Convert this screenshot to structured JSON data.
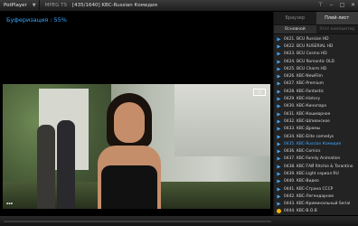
{
  "titlebar": {
    "app_name": "PotPlayer",
    "codec": "MPEG TS",
    "file_title": "[435/1640] KBC-Russian Комедия"
  },
  "video": {
    "buffering_text": "Буферизация : 55%",
    "buffering_percent": 55
  },
  "panel": {
    "tabs": [
      "Браузер",
      "Плей-лист"
    ],
    "active_tab": "Плей-лист",
    "subtabs": [
      "Основной",
      "Этот компьютер"
    ],
    "active_subtab": "Основной",
    "items": [
      {
        "label": "0421. BCU Russian HD"
      },
      {
        "label": "0422. BCU RUSERIAL HD"
      },
      {
        "label": "0423. BCU Cosmo HD"
      },
      {
        "label": "0424. BCU Romantic OLD"
      },
      {
        "label": "0425. BCU Charm HD"
      },
      {
        "label": "0426. KBC-NewFilm"
      },
      {
        "label": "0427. KBC-Premium"
      },
      {
        "label": "0428. KBC-Fantastic"
      },
      {
        "label": "0429. KBC-History"
      },
      {
        "label": "0430. KBC-Кинопара"
      },
      {
        "label": "0431. KBC-Кошмарное"
      },
      {
        "label": "0432. KBC-Шпионское"
      },
      {
        "label": "0433. KBC-Драмы"
      },
      {
        "label": "0434. KBC-Elite comedys"
      },
      {
        "label": "0435. KBC-Russian Комедия"
      },
      {
        "label": "0436. KBC-Comics"
      },
      {
        "label": "0437. KBC-Family Animation"
      },
      {
        "label": "0438. KBC-ТАЙ Ritchie & Tarantino"
      },
      {
        "label": "0439. KBC-Light сериал RU"
      },
      {
        "label": "0440. KBC-Видео"
      },
      {
        "label": "0441. KBC-Страна СССР"
      },
      {
        "label": "0442. KBC-Легендарное"
      },
      {
        "label": "0443. KBC-Криминальный Serial"
      },
      {
        "label": "0444. KBC-В.О.В"
      }
    ],
    "selected_index": 14
  },
  "colors": {
    "accent": "#3fa9ff",
    "buffer_text": "#38a8ff",
    "last_item_icon": "#f0b400"
  }
}
